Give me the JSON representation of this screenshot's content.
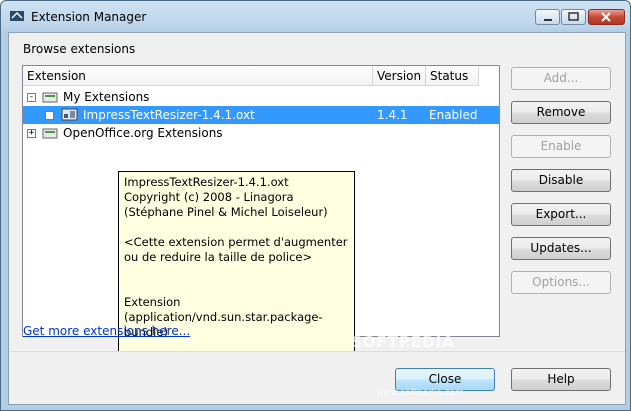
{
  "window": {
    "title": "Extension Manager"
  },
  "browse_label": "Browse extensions",
  "columns": {
    "extension": "Extension",
    "version": "Version",
    "status": "Status"
  },
  "tree": {
    "my_extensions": {
      "label": "My Extensions",
      "expander": "⊟"
    },
    "selected_item": {
      "label": "ImpressTextResizer-1.4.1.oxt",
      "version": "1.4.1",
      "status": "Enabled",
      "expander": "+"
    },
    "openoffice_extensions": {
      "label": "OpenOffice.org Extensions",
      "expander": "+"
    }
  },
  "tooltip": {
    "text": "ImpressTextResizer-1.4.1.oxt\nCopyright (c) 2008 - Linagora (Stéphane Pinel & Michel Loiseleur)\n\n<Cette extension permet d'augmenter ou de reduire la taille de police>\n\n\nExtension\n(application/vnd.sun.star.package-bundle)"
  },
  "buttons": {
    "add": "Add...",
    "remove": "Remove",
    "enable": "Enable",
    "disable": "Disable",
    "export": "Export...",
    "updates": "Updates...",
    "options": "Options...",
    "close": "Close",
    "help": "Help"
  },
  "link": "Get more extensions here...",
  "watermark": {
    "main": "SOFTPEDIA",
    "sub": "www.softpedia.com"
  }
}
